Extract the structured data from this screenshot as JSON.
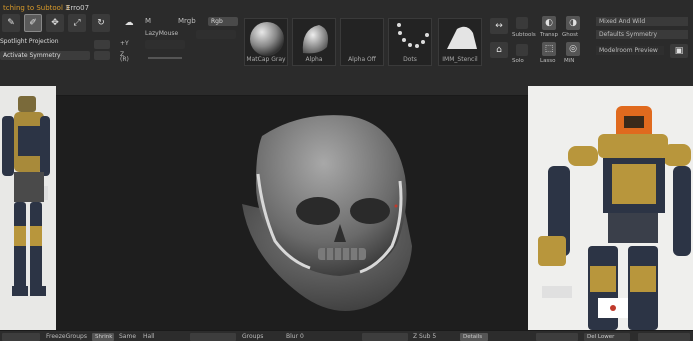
{
  "top": {
    "status": "tching to Subtool 3",
    "status2": "Erro07",
    "spotlight": "Spotlight Projection",
    "activate_symmetry": "Activate Symmetry",
    "tools": [
      {
        "label": "Edit",
        "icon": "edit-icon"
      },
      {
        "label": "Draw",
        "icon": "draw-icon"
      },
      {
        "label": "Move",
        "icon": "move-icon"
      },
      {
        "label": "Scale",
        "icon": "scale-icon"
      },
      {
        "label": "Rotate",
        "icon": "rotate-icon"
      },
      {
        "label": "Orb",
        "icon": "orb-icon"
      }
    ],
    "m_label": "M",
    "mrgb": "Mrgb",
    "rgb": "Rgb",
    "lazymouse": "LazyMouse",
    "z_label": "Z",
    "r_label": "(R)",
    "brushes": [
      {
        "label": "MatCap Gray"
      },
      {
        "label": "Alpha"
      },
      {
        "label": "Alpha Off"
      },
      {
        "label": "Dots"
      },
      {
        "label": "IMM_Stencil"
      }
    ],
    "right_fields": [
      "Mixed And Wild",
      "Defaults Symmetry",
      "Modelroom Preview"
    ],
    "solo_labels": [
      "Subtools",
      "Transp",
      "Ghost",
      "Solo",
      "Lasso",
      "MiN"
    ]
  },
  "bottom": {
    "items": [
      "FreezeGroups",
      "Shrink",
      "Same",
      "Hall",
      "Groups",
      "Blur 0",
      "Z Sub 5",
      "Details",
      "Del Lower"
    ]
  },
  "colors": {
    "accent_orange": "#d89a2a",
    "active_tool": "#5a5a5a",
    "armor_gold": "#b8963c",
    "armor_blue": "#2c3445",
    "mask_orange": "#e06a1e"
  }
}
